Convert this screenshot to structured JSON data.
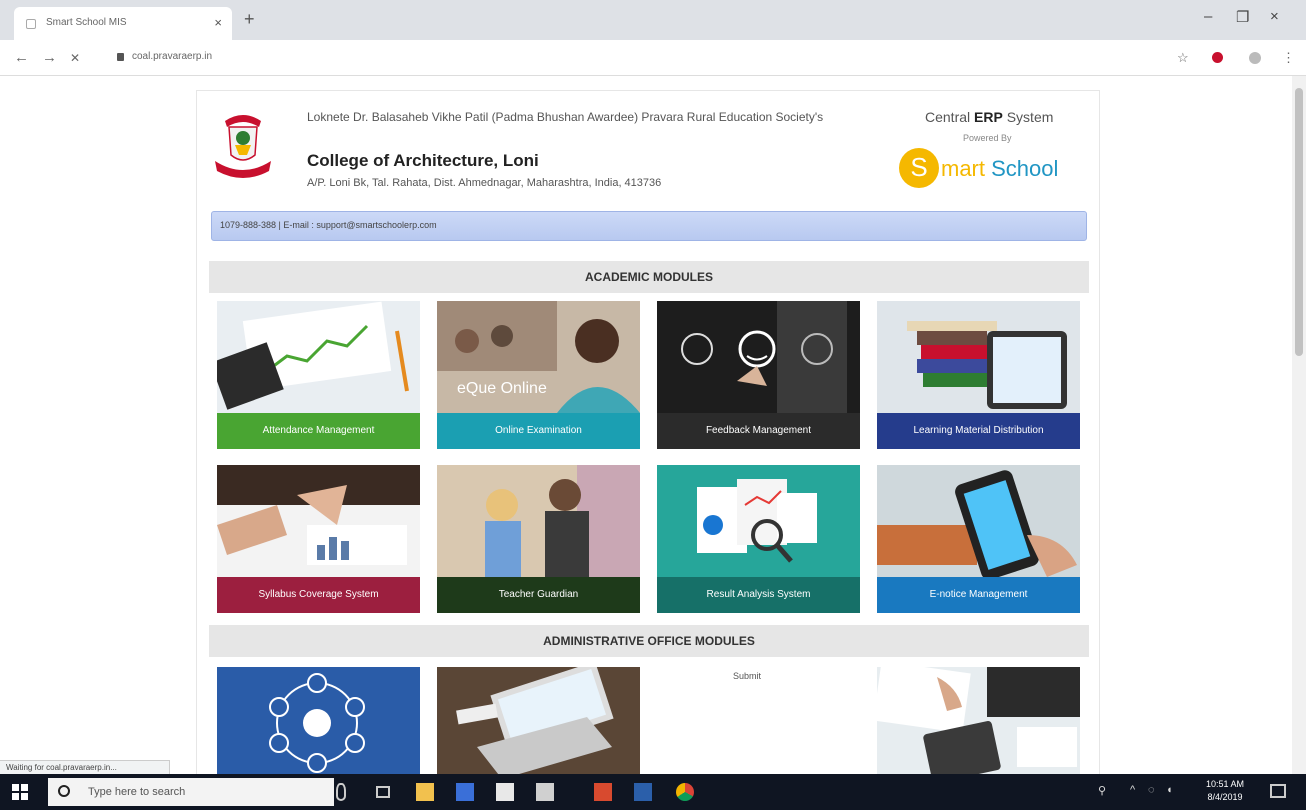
{
  "browser": {
    "tab_title": "Smart School MIS",
    "tab_close": "×",
    "new_tab": "+",
    "win_minimize": "–",
    "win_restore": "❐",
    "win_close": "×",
    "back": "←",
    "forward": "→",
    "stop": "✕",
    "url": "coal.pravaraerp.in",
    "star": "☆",
    "menu": "⋮"
  },
  "header": {
    "society": "Loknete Dr. Balasaheb Vikhe Patil (Padma Bhushan Awardee) Pravara Rural Education Society's",
    "college": "College of Architecture, Loni",
    "address": "A/P. Loni Bk, Tal. Rahata, Dist. Ahmednagar, Maharashtra, India, 413736",
    "erp_prefix": "Central ",
    "erp_bold": "ERP",
    "erp_suffix": " System",
    "powered_by": "Powered By",
    "logo_letter": "S",
    "logo_text_a": "mart ",
    "logo_text_b": "School",
    "contact": "1079-888-388 | E-mail : support@smartschoolerp.com"
  },
  "sections": {
    "academic": "ACADEMIC MODULES",
    "administrative": "ADMINISTRATIVE OFFICE MODULES"
  },
  "academic_modules": [
    {
      "label": "Attendance Management",
      "color": "#49a532"
    },
    {
      "label": "Online Examination",
      "color": "#1b9fb2",
      "overlay": "eQue Online"
    },
    {
      "label": "Feedback Management",
      "color": "#2b2b2b"
    },
    {
      "label": "Learning Material Distribution",
      "color": "#253c8c"
    },
    {
      "label": "Syllabus Coverage System",
      "color": "#9c1f3f"
    },
    {
      "label": "Teacher Guardian",
      "color": "#1e3a1a"
    },
    {
      "label": "Result Analysis System",
      "color": "#167068"
    },
    {
      "label": "E-notice Management",
      "color": "#1979c0"
    }
  ],
  "admin_modules": [
    {
      "label": ""
    },
    {
      "label": ""
    },
    {
      "label": "Submit"
    },
    {
      "label": ""
    }
  ],
  "status_bar": "Waiting for coal.pravaraerp.in...",
  "taskbar": {
    "search_placeholder": "Type here to search",
    "time": "10:51 AM",
    "date": "8/4/2019"
  }
}
